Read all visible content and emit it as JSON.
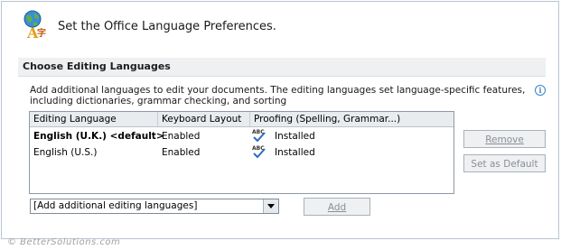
{
  "header": {
    "title": "Set the Office Language Preferences.",
    "icon": "globe-language-icon"
  },
  "section": {
    "title": "Choose Editing Languages",
    "description": "Add additional languages to edit your documents. The editing languages set language-specific features, including dictionaries, grammar checking, and sorting"
  },
  "table": {
    "columns": [
      "Editing Language",
      "Keyboard Layout",
      "Proofing (Spelling, Grammar...)"
    ],
    "rows": [
      {
        "language": "English (U.K.) <default>",
        "keyboard": "Enabled",
        "proofing": "Installed",
        "bold": true
      },
      {
        "language": "English (U.S.)",
        "keyboard": "Enabled",
        "proofing": "Installed",
        "bold": false
      }
    ]
  },
  "buttons": {
    "remove": "Remove",
    "set_default": "Set as Default",
    "add": "Add"
  },
  "dropdown": {
    "value": "[Add additional editing languages]"
  },
  "footer": {
    "watermark": "© BetterSolutions.com"
  },
  "colors": {
    "border": "#b9c4d0",
    "section_bg": "#eef0f2",
    "disabled_text": "#8a8f95",
    "info_blue": "#3b82c4"
  }
}
